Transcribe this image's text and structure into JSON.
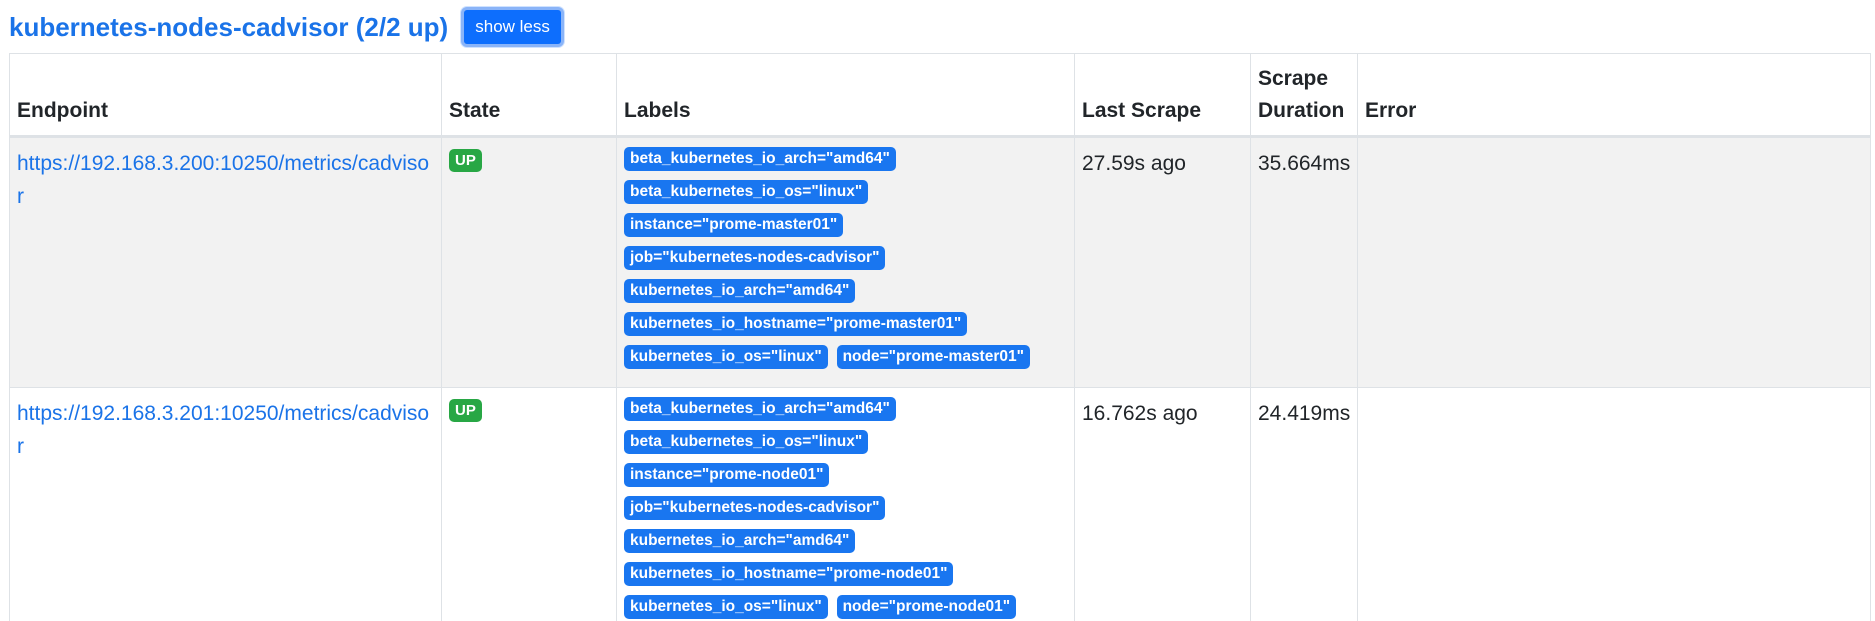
{
  "job": {
    "title": "kubernetes-nodes-cadvisor (2/2 up)",
    "toggle_label": "show less"
  },
  "table": {
    "headers": {
      "endpoint": "Endpoint",
      "state": "State",
      "labels": "Labels",
      "last_scrape": "Last Scrape",
      "scrape_duration": "Scrape Duration",
      "error": "Error"
    },
    "rows": [
      {
        "endpoint": "https://192.168.3.200:10250/metrics/cadvisor",
        "state": "UP",
        "labels": [
          "beta_kubernetes_io_arch=\"amd64\"",
          "beta_kubernetes_io_os=\"linux\"",
          "instance=\"prome-master01\"",
          "job=\"kubernetes-nodes-cadvisor\"",
          "kubernetes_io_arch=\"amd64\"",
          "kubernetes_io_hostname=\"prome-master01\"",
          "kubernetes_io_os=\"linux\"",
          "node=\"prome-master01\""
        ],
        "last_scrape": "27.59s ago",
        "scrape_duration": "35.664ms",
        "error": ""
      },
      {
        "endpoint": "https://192.168.3.201:10250/metrics/cadvisor",
        "state": "UP",
        "labels": [
          "beta_kubernetes_io_arch=\"amd64\"",
          "beta_kubernetes_io_os=\"linux\"",
          "instance=\"prome-node01\"",
          "job=\"kubernetes-nodes-cadvisor\"",
          "kubernetes_io_arch=\"amd64\"",
          "kubernetes_io_hostname=\"prome-node01\"",
          "kubernetes_io_os=\"linux\"",
          "node=\"prome-node01\""
        ],
        "last_scrape": "16.762s ago",
        "scrape_duration": "24.419ms",
        "error": ""
      }
    ]
  },
  "colors": {
    "link": "#1a73e8",
    "label_badge": "#1976f0",
    "up_badge": "#28a745",
    "row_stripe": "#f2f2f2"
  }
}
